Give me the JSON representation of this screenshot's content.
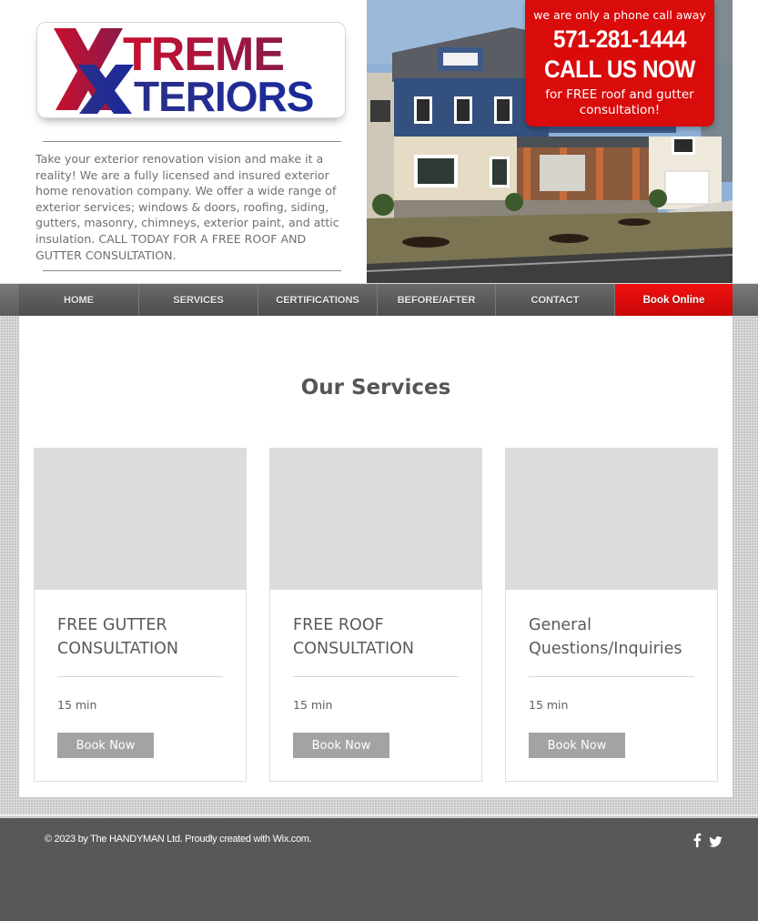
{
  "header": {
    "logo": {
      "line1": "TREME",
      "line2": "TERIORS",
      "alt": "XTREME XTERIORS"
    },
    "intro_text": "Take your exterior renovation vision and make it a reality! We are a fully licensed and insured exterior home renovation company. We offer a wide range of exterior services; windows & doors, roofing, siding, gutters, masonry, chimneys, exterior paint, and attic insulation. CALL TODAY FOR A FREE ROOF AND GUTTER CONSULTATION."
  },
  "callout": {
    "tagline": "we are only a phone call away",
    "phone": "571-281-1444",
    "cta": "CALL US NOW",
    "subtext": "for FREE roof and gutter consultation!",
    "color": "#d90b0b"
  },
  "nav": {
    "items": [
      {
        "label": "HOME"
      },
      {
        "label": "SERVICES"
      },
      {
        "label": "CERTIFICATIONS"
      },
      {
        "label": "BEFORE/AFTER"
      },
      {
        "label": "CONTACT"
      },
      {
        "label": "Book Online"
      }
    ],
    "accent": "#e00b0b"
  },
  "services": {
    "title": "Our Services",
    "cards": [
      {
        "name": "FREE GUTTER CONSULTATION",
        "duration": "15 min",
        "button": "Book Now"
      },
      {
        "name": "FREE ROOF CONSULTATION",
        "duration": "15 min",
        "button": "Book Now"
      },
      {
        "name": "General Questions/Inquiries",
        "duration": "15 min",
        "button": "Book Now"
      }
    ]
  },
  "footer": {
    "copyright": "© 2023 by The HANDYMAN Ltd. Proudly created with Wix.com.",
    "social_icons": [
      "facebook-icon",
      "twitter-icon"
    ]
  }
}
